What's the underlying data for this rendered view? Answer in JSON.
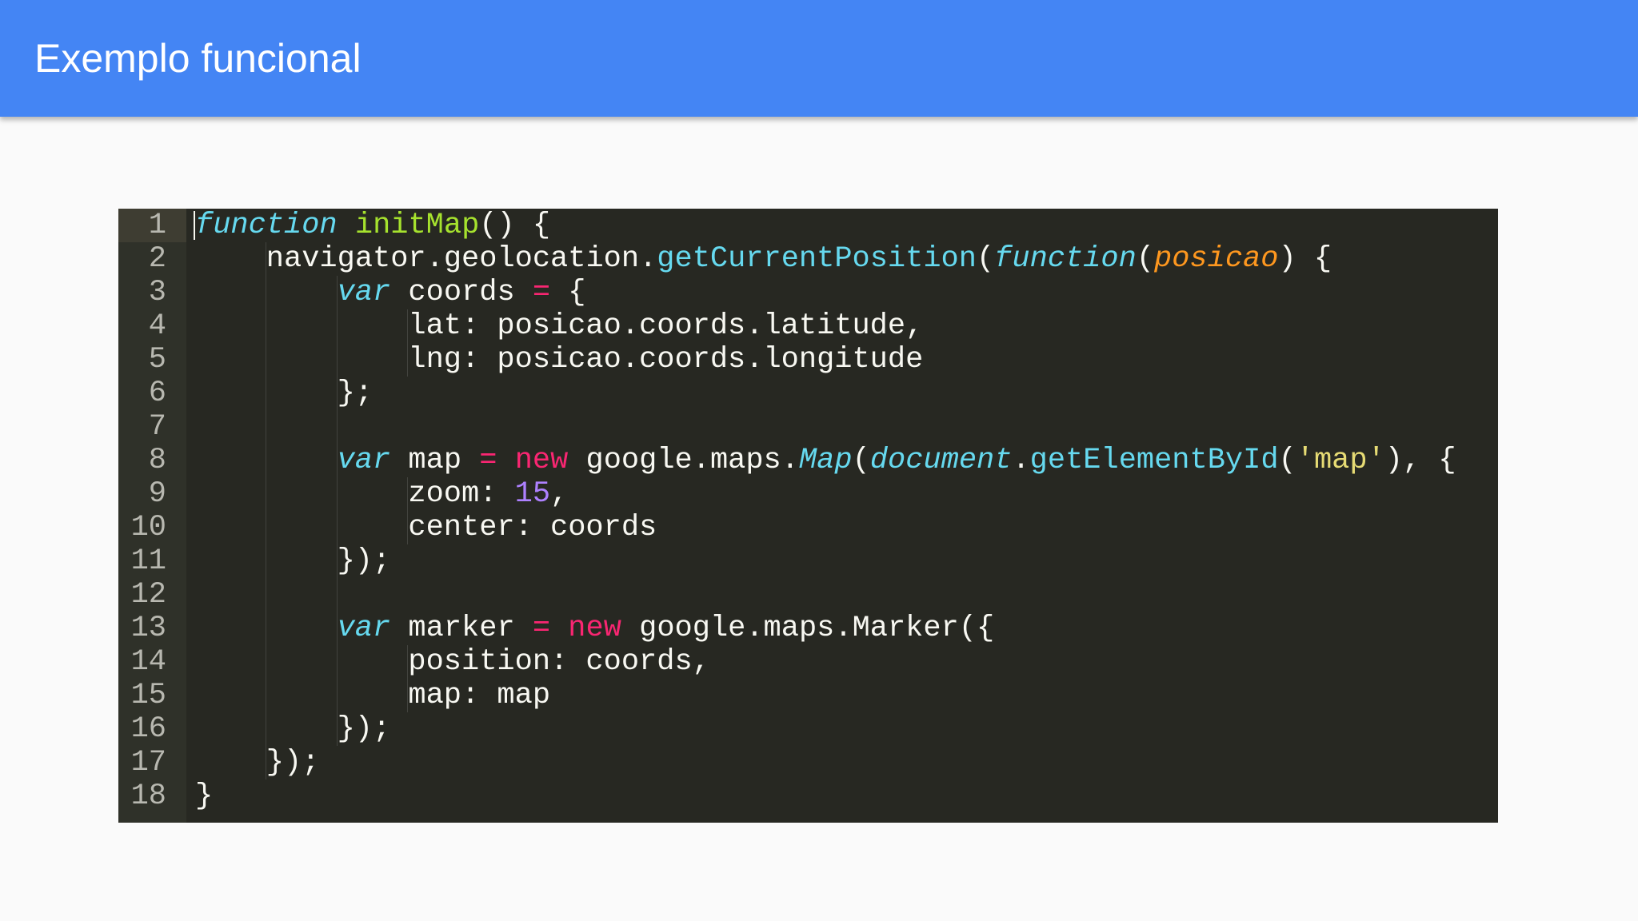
{
  "slide": {
    "title": "Exemplo funcional"
  },
  "colors": {
    "header_bg": "#4485f4",
    "page_bg": "#fafafa",
    "editor_bg": "#272822",
    "gutter_bg": "#2f3129",
    "keyword": "#66d9ef",
    "function_name": "#a6e22e",
    "parameter": "#fd971f",
    "operator": "#f92672",
    "number": "#ae81ff",
    "string": "#e6db74",
    "plain": "#f8f8f2"
  },
  "code": {
    "active_line": 1,
    "lines": [
      {
        "n": "1",
        "indent": 0,
        "tokens": [
          [
            "kw",
            "function"
          ],
          [
            "",
            "&nbsp;"
          ],
          [
            "fn",
            "initMap"
          ],
          [
            "",
            "() {"
          ]
        ]
      },
      {
        "n": "2",
        "indent": 1,
        "tokens": [
          [
            "",
            "navigator.geolocation."
          ],
          [
            "cl",
            "getCurrentPosition"
          ],
          [
            "",
            "("
          ],
          [
            "kw",
            "function"
          ],
          [
            "",
            "("
          ],
          [
            "prm",
            "posicao"
          ],
          [
            "",
            ") {"
          ]
        ]
      },
      {
        "n": "3",
        "indent": 2,
        "tokens": [
          [
            "kw",
            "var"
          ],
          [
            "",
            "&nbsp;coords "
          ],
          [
            "op",
            "="
          ],
          [
            "",
            "&nbsp;{"
          ]
        ]
      },
      {
        "n": "4",
        "indent": 3,
        "tokens": [
          [
            "",
            "lat: posicao.coords.latitude,"
          ]
        ]
      },
      {
        "n": "5",
        "indent": 3,
        "tokens": [
          [
            "",
            "lng: posicao.coords.longitude"
          ]
        ]
      },
      {
        "n": "6",
        "indent": 2,
        "tokens": [
          [
            "",
            "};"
          ]
        ]
      },
      {
        "n": "7",
        "indent": 0,
        "guides": 2,
        "tokens": []
      },
      {
        "n": "8",
        "indent": 2,
        "tokens": [
          [
            "kw",
            "var"
          ],
          [
            "",
            "&nbsp;map "
          ],
          [
            "op",
            "="
          ],
          [
            "",
            "&nbsp;"
          ],
          [
            "nw",
            "new"
          ],
          [
            "",
            "&nbsp;google.maps."
          ],
          [
            "kw",
            "Map"
          ],
          [
            "",
            "("
          ],
          [
            "kw",
            "document"
          ],
          [
            "",
            "."
          ],
          [
            "cl",
            "getElementById"
          ],
          [
            "",
            "("
          ],
          [
            "str",
            "'map'"
          ],
          [
            "",
            "), {"
          ]
        ]
      },
      {
        "n": "9",
        "indent": 3,
        "tokens": [
          [
            "",
            "zoom: "
          ],
          [
            "num",
            "15"
          ],
          [
            "",
            ","
          ]
        ]
      },
      {
        "n": "10",
        "indent": 3,
        "tokens": [
          [
            "",
            "center: coords"
          ]
        ]
      },
      {
        "n": "11",
        "indent": 2,
        "tokens": [
          [
            "",
            "});"
          ]
        ]
      },
      {
        "n": "12",
        "indent": 0,
        "guides": 2,
        "tokens": []
      },
      {
        "n": "13",
        "indent": 2,
        "tokens": [
          [
            "kw",
            "var"
          ],
          [
            "",
            "&nbsp;marker "
          ],
          [
            "op",
            "="
          ],
          [
            "",
            "&nbsp;"
          ],
          [
            "nw",
            "new"
          ],
          [
            "",
            "&nbsp;google.maps.Marker({"
          ]
        ]
      },
      {
        "n": "14",
        "indent": 3,
        "tokens": [
          [
            "",
            "position: coords,"
          ]
        ]
      },
      {
        "n": "15",
        "indent": 3,
        "tokens": [
          [
            "",
            "map: map"
          ]
        ]
      },
      {
        "n": "16",
        "indent": 2,
        "tokens": [
          [
            "",
            "});"
          ]
        ]
      },
      {
        "n": "17",
        "indent": 1,
        "tokens": [
          [
            "",
            "});"
          ]
        ]
      },
      {
        "n": "18",
        "indent": 0,
        "tokens": [
          [
            "",
            "}"
          ]
        ]
      }
    ]
  }
}
